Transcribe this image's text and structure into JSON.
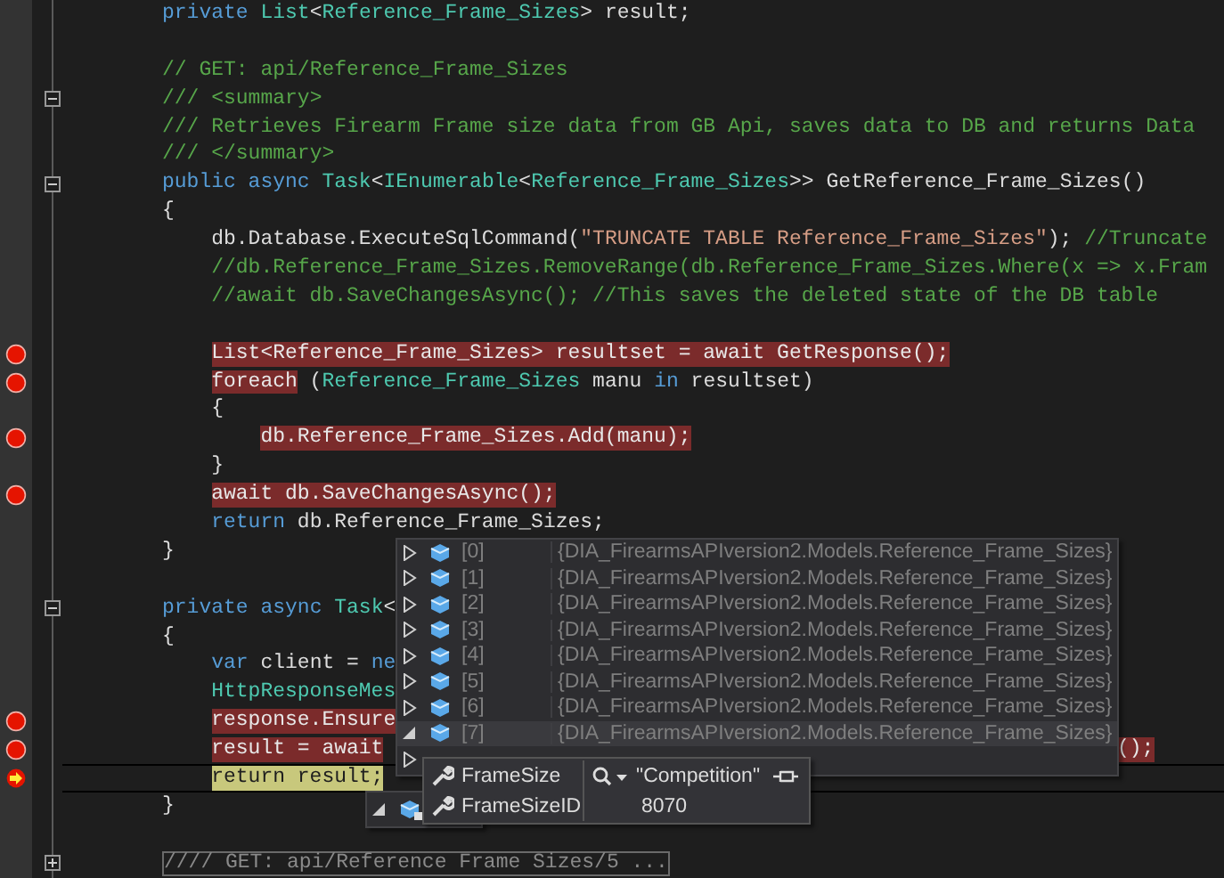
{
  "lines": [
    {
      "breakpoint": false,
      "current": false,
      "tokens": [
        {
          "text": "private ",
          "kind": "keyword"
        },
        {
          "text": "List",
          "kind": "type"
        },
        {
          "text": "<",
          "kind": "plain"
        },
        {
          "text": "Reference_Frame_Sizes",
          "kind": "type"
        },
        {
          "text": "> result;",
          "kind": "plain"
        }
      ]
    },
    {
      "breakpoint": false,
      "current": false
    },
    {
      "breakpoint": false,
      "current": false,
      "tokens": [
        {
          "text": "// GET: api/Reference_Frame_Sizes",
          "kind": "comment"
        }
      ]
    },
    {
      "breakpoint": false,
      "current": false,
      "expanded": true,
      "tokens": [
        {
          "text": "/// <summary>",
          "kind": "comment"
        }
      ]
    },
    {
      "breakpoint": false,
      "current": false,
      "tokens": [
        {
          "text": "/// Retrieves Firearm Frame size data from GB Api, saves data to DB and returns Data",
          "kind": "comment"
        }
      ]
    },
    {
      "breakpoint": false,
      "current": false,
      "tokens": [
        {
          "text": "/// </summary>",
          "kind": "comment"
        }
      ]
    },
    {
      "breakpoint": false,
      "current": false,
      "expanded": true,
      "tokens": [
        {
          "text": "public async ",
          "kind": "keyword"
        },
        {
          "text": "Task",
          "kind": "type"
        },
        {
          "text": "<",
          "kind": "plain"
        },
        {
          "text": "IEnumerable",
          "kind": "type"
        },
        {
          "text": "<",
          "kind": "plain"
        },
        {
          "text": "Reference_Frame_Sizes",
          "kind": "type"
        },
        {
          "text": ">> GetReference_Frame_Sizes()",
          "kind": "plain"
        }
      ]
    },
    {
      "breakpoint": false,
      "current": false,
      "tokens": [
        {
          "text": "{",
          "kind": "plain"
        }
      ],
      "children": [
        {
          "breakpoint": false,
          "current": false,
          "tokens": [
            {
              "text": "db.Database.ExecuteSqlCommand(",
              "kind": "plain"
            },
            {
              "text": "\"TRUNCATE TABLE Reference_Frame_Sizes\"",
              "kind": "string"
            },
            {
              "text": ");",
              "kind": "plain"
            },
            {
              "text": " //Truncate",
              "kind": "comment"
            }
          ]
        },
        {
          "breakpoint": false,
          "current": false,
          "tokens": [
            {
              "text": "//db.Reference_Frame_Sizes.RemoveRange(db.Reference_Frame_Sizes.Where(x => x.Fram",
              "kind": "comment"
            }
          ]
        },
        {
          "breakpoint": false,
          "current": false,
          "tokens": [
            {
              "text": "//await db.SaveChangesAsync(); //This saves the deleted state of the DB table",
              "kind": "comment"
            }
          ]
        },
        {
          "breakpoint": false,
          "current": false
        },
        {
          "breakpoint": true,
          "current": false,
          "tokens": [
            {
              "text": "List<Reference_Frame_Sizes> resultset = await GetResponse();",
              "kind": "breakpoint"
            }
          ]
        },
        {
          "breakpoint": true,
          "current": false,
          "tokens": [
            {
              "text": "foreach",
              "kind": "breakpoint"
            },
            {
              "text": " (",
              "kind": "plain"
            },
            {
              "text": "Reference_Frame_Sizes",
              "kind": "type"
            },
            {
              "text": " manu ",
              "kind": "plain"
            },
            {
              "text": "in",
              "kind": "keyword"
            },
            {
              "text": " resultset)",
              "kind": "plain"
            }
          ]
        },
        {
          "breakpoint": false,
          "current": false,
          "tokens": [
            {
              "text": "{",
              "kind": "plain"
            }
          ],
          "children": [
            {
              "breakpoint": true,
              "current": false,
              "tokens": [
                {
                  "text": "db.Reference_Frame_Sizes.Add(manu);",
                  "kind": "breakpoint"
                }
              ]
            }
          ]
        },
        {
          "breakpoint": false,
          "current": false,
          "tokens": [
            {
              "text": "}",
              "kind": "plain"
            }
          ]
        },
        {
          "breakpoint": true,
          "current": false,
          "tokens": [
            {
              "text": "await db.SaveChangesAsync();",
              "kind": "breakpoint"
            }
          ]
        },
        {
          "breakpoint": false,
          "current": false,
          "tokens": [
            {
              "text": "return",
              "kind": "keyword"
            },
            {
              "text": " db.Reference_Frame_Sizes;",
              "kind": "plain"
            }
          ]
        }
      ]
    },
    {
      "breakpoint": false,
      "current": false,
      "tokens": [
        {
          "text": "}",
          "kind": "plain"
        }
      ]
    },
    {
      "breakpoint": false,
      "current": false
    },
    {
      "breakpoint": false,
      "current": false,
      "expanded": true,
      "tokens": [
        {
          "text": "private async ",
          "kind": "keyword"
        },
        {
          "text": "Task",
          "kind": "type"
        },
        {
          "text": "<",
          "kind": "plain"
        }
      ]
    },
    {
      "breakpoint": false,
      "current": false,
      "tokens": [
        {
          "text": "{",
          "kind": "plain"
        }
      ],
      "children": [
        {
          "breakpoint": false,
          "current": false,
          "tokens": [
            {
              "text": "var",
              "kind": "keyword"
            },
            {
              "text": " client = ",
              "kind": "plain"
            },
            {
              "text": "ne",
              "kind": "keyword"
            }
          ]
        },
        {
          "breakpoint": false,
          "current": false,
          "tokens": [
            {
              "text": "HttpResponseMes",
              "kind": "type"
            }
          ]
        },
        {
          "breakpoint": true,
          "current": false,
          "tokens": [
            {
              "text": "response.Ensure",
              "kind": "breakpoint"
            }
          ]
        },
        {
          "breakpoint": true,
          "current": false,
          "tail": "();",
          "tokens": [
            {
              "text": "result = await",
              "kind": "breakpoint"
            }
          ]
        },
        {
          "breakpoint": false,
          "current": true,
          "tokens": [
            {
              "text": "return result;",
              "kind": "current"
            }
          ]
        }
      ]
    },
    {
      "breakpoint": false,
      "current": false,
      "tokens": [
        {
          "text": "}",
          "kind": "plain"
        }
      ]
    },
    {
      "breakpoint": false,
      "current": false
    },
    {
      "breakpoint": false,
      "current": false,
      "expanded": false,
      "tokens": [
        {
          "text": "//// GET: api/Reference Frame Sizes/5 ...",
          "kind": "collapsed"
        }
      ]
    }
  ],
  "datatip": {
    "items": [
      {
        "index": "[0]",
        "value": "{DIA_FirearmsAPIversion2.Models.Reference_Frame_Sizes}",
        "expanded": false,
        "selected": false
      },
      {
        "index": "[1]",
        "value": "{DIA_FirearmsAPIversion2.Models.Reference_Frame_Sizes}",
        "expanded": false,
        "selected": false
      },
      {
        "index": "[2]",
        "value": "{DIA_FirearmsAPIversion2.Models.Reference_Frame_Sizes}",
        "expanded": false,
        "selected": false
      },
      {
        "index": "[3]",
        "value": "{DIA_FirearmsAPIversion2.Models.Reference_Frame_Sizes}",
        "expanded": false,
        "selected": false
      },
      {
        "index": "[4]",
        "value": "{DIA_FirearmsAPIversion2.Models.Reference_Frame_Sizes}",
        "expanded": false,
        "selected": false
      },
      {
        "index": "[5]",
        "value": "{DIA_FirearmsAPIversion2.Models.Reference_Frame_Sizes}",
        "expanded": false,
        "selected": false
      },
      {
        "index": "[6]",
        "value": "{DIA_FirearmsAPIversion2.Models.Reference_Frame_Sizes}",
        "expanded": false,
        "selected": false
      },
      {
        "index": "[7]",
        "value": "{DIA_FirearmsAPIversion2.Models.Reference_Frame_Sizes}",
        "expanded": true,
        "selected": true
      },
      {
        "expanded": false,
        "selected": false
      }
    ],
    "root": {
      "expanded": true
    },
    "members": [
      {
        "name": "FrameSize",
        "value": "\"Competition\"",
        "kind": "string"
      },
      {
        "name": "FrameSizeID",
        "value": "8070",
        "kind": "number"
      }
    ]
  }
}
